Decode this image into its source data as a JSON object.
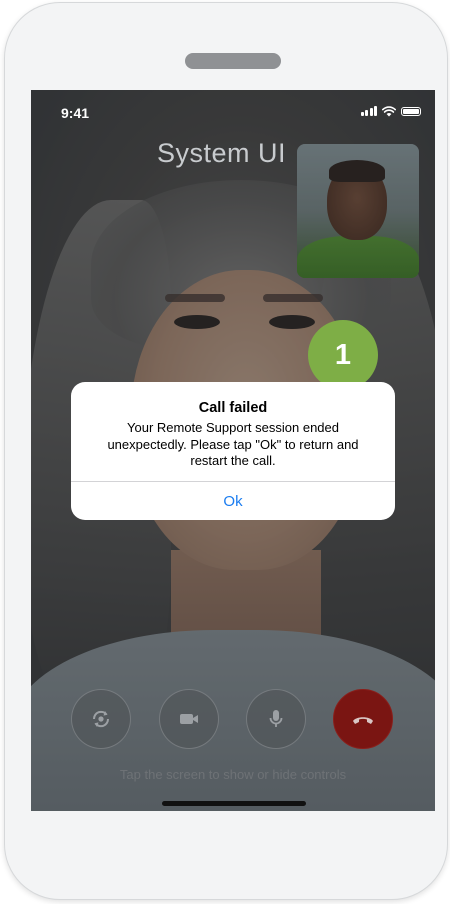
{
  "status_bar": {
    "time": "9:41"
  },
  "overlay_label": "System UI",
  "step_badge": "1",
  "alert": {
    "title": "Call failed",
    "message": "Your Remote Support session ended unexpectedly. Please tap \"Ok\" to return and restart the call.",
    "ok_label": "Ok"
  },
  "controls": {
    "hint": "Tap the screen to show or hide controls",
    "buttons": [
      {
        "icon": "switch-camera-icon"
      },
      {
        "icon": "video-camera-icon"
      },
      {
        "icon": "microphone-icon"
      },
      {
        "icon": "end-call-icon"
      }
    ]
  },
  "colors": {
    "badge": "#7eae46",
    "ok_button": "#1a7cf0",
    "end_call": "#7a1512",
    "alert_background": "#ffffff"
  }
}
